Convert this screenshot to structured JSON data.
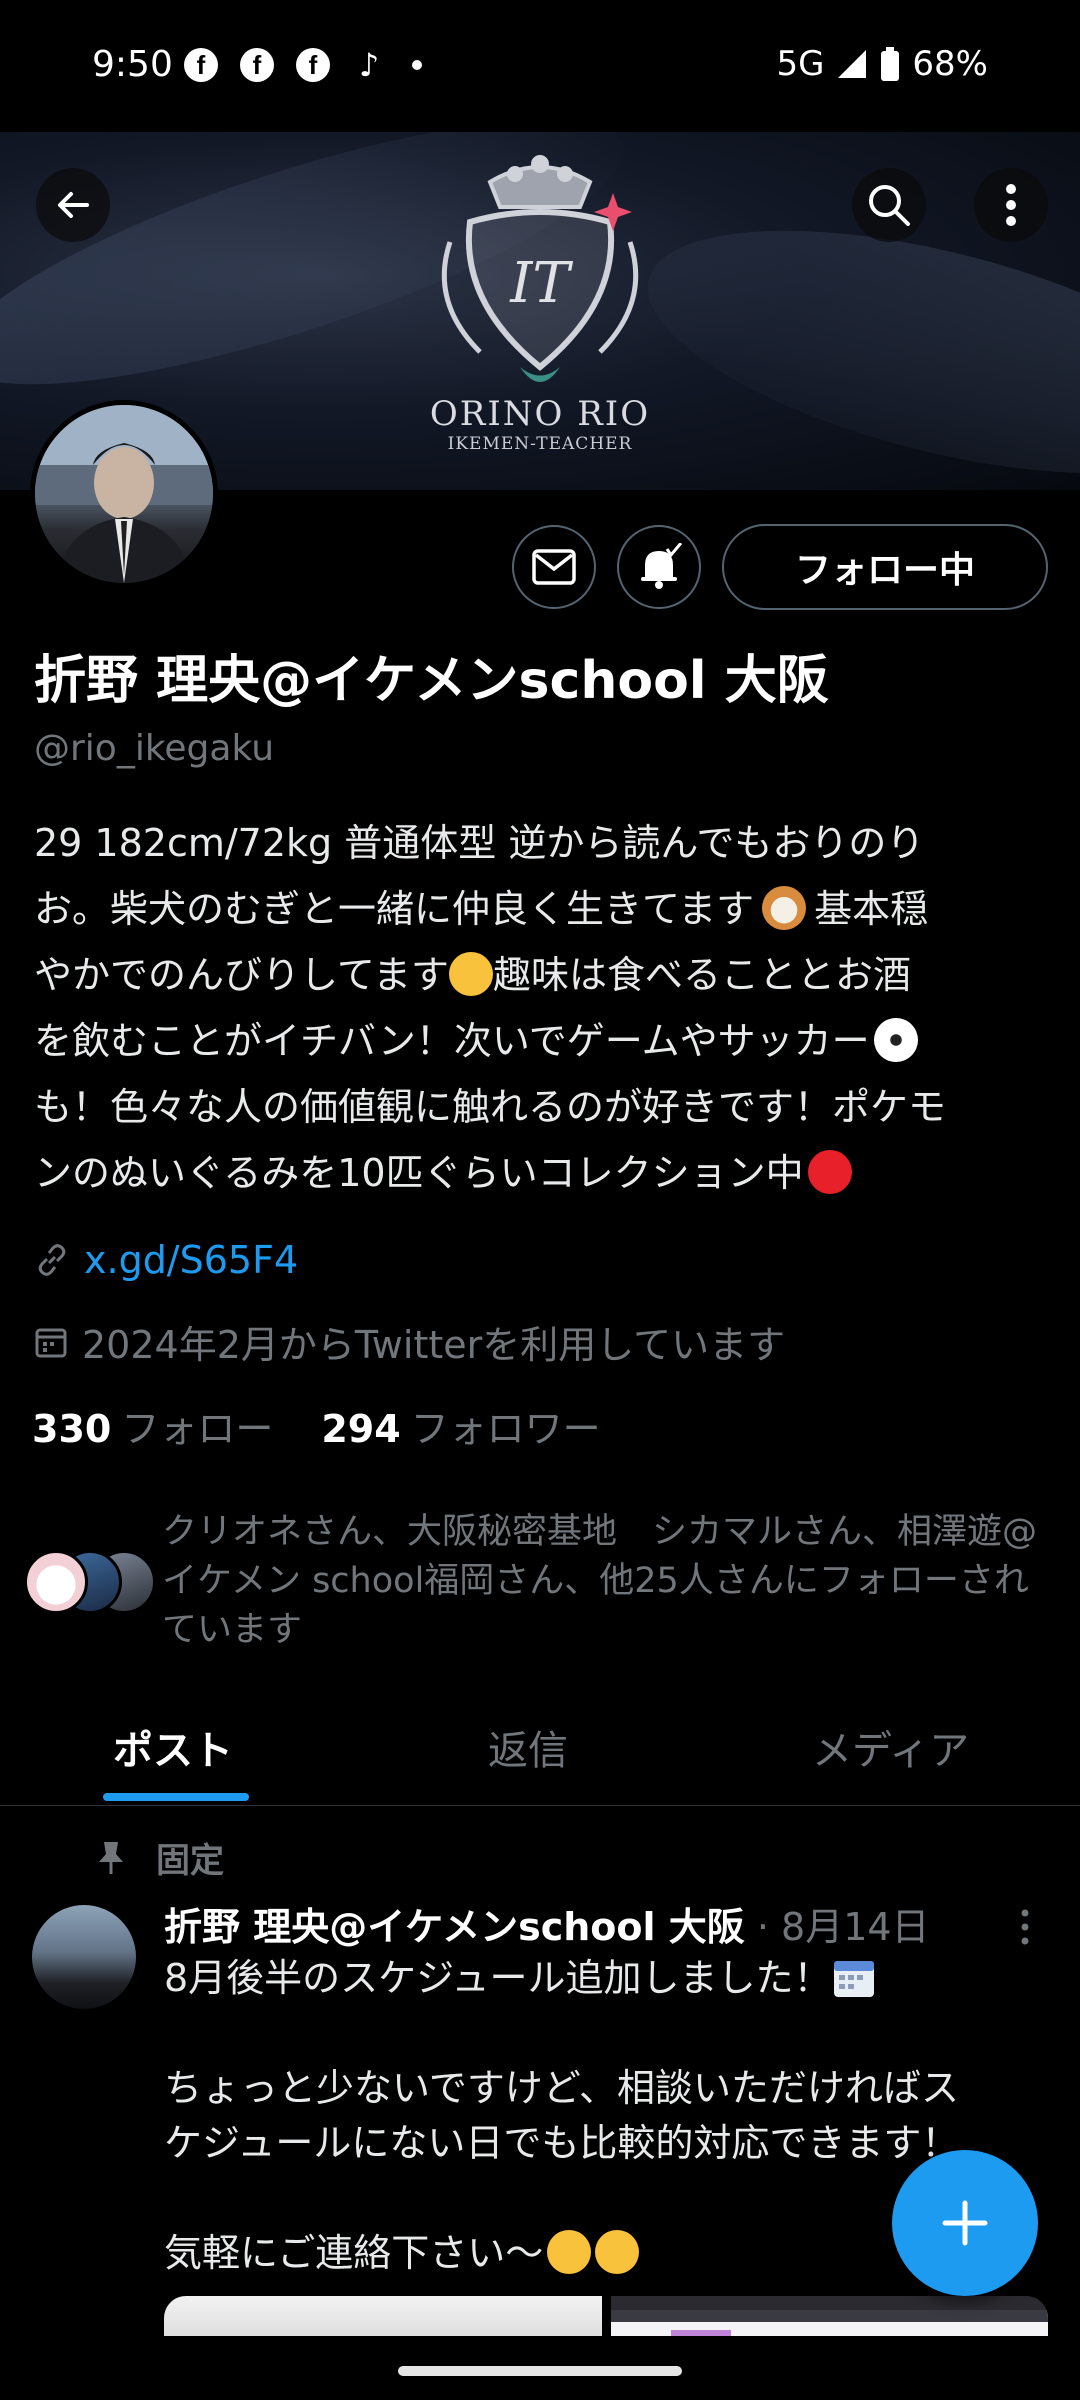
{
  "status_bar": {
    "time": "9:50",
    "network": "5G",
    "battery": "68%",
    "notification_icons": [
      "facebook-icon",
      "facebook-icon",
      "facebook-icon",
      "tiktok-icon"
    ]
  },
  "banner": {
    "title": "ORINO RIO",
    "subtitle": "IKEMEN-TEACHER",
    "monogram": "IT"
  },
  "profile": {
    "name": "折野 理央@イケメンschool 大阪",
    "handle": "@rio_ikegaku",
    "bio_lines": [
      "29 182cm/72kg 普通体型 逆から読んでもおりのり",
      "お。柴犬のむぎと一緒に仲良く生きてます",
      "基本穏",
      "やかでのんびりしてます",
      "趣味は食べることとお酒",
      "を飲むことがイチバン！次いでゲームやサッカー",
      "も！色々な人の価値観に触れるのが好きです！ポケモ",
      "ンのぬいぐるみを10匹ぐらいコレクション中"
    ],
    "link": "x.gd/S65F4",
    "joined": "2024年2月からTwitterを利用しています",
    "following_count": "330",
    "following_label": "フォロー",
    "followers_count": "294",
    "followers_label": "フォロワー",
    "follow_button": "フォロー中",
    "followed_by": "クリオネさん、大阪秘密基地　シカマルさん、相澤遊@イケメン school福岡さん、他25人さんにフォローされています"
  },
  "tabs": [
    {
      "label": "ポスト",
      "active": true
    },
    {
      "label": "返信",
      "active": false
    },
    {
      "label": "メディア",
      "active": false
    }
  ],
  "pinned_post": {
    "pinned_label": "固定",
    "author": "折野 理央@イケメンschool 大阪",
    "date": "· 8月14日",
    "lines": [
      "8月後半のスケジュール追加しました！",
      "",
      "ちょっと少ないですけど、相談いただければス",
      "ケジュールにない日でも比較的対応できます！",
      "",
      "気軽にご連絡下さい〜"
    ]
  },
  "colors": {
    "accent": "#1d9bf0",
    "background": "#000000",
    "muted_text": "#71767b",
    "border": "#2f3336"
  }
}
